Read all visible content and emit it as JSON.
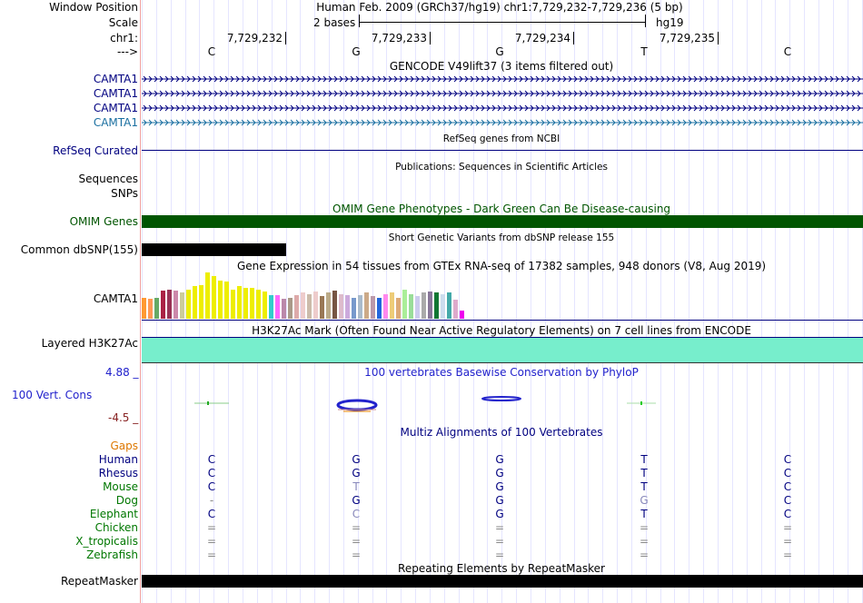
{
  "header": {
    "window_position_label": "Window Position",
    "window_position_value": "Human Feb. 2009 (GRCh37/hg19)   chr1:7,729,232-7,729,236 (5 bp)",
    "scale_label": "Scale",
    "scale_bases": "2 bases",
    "scale_db": "hg19",
    "chr_label": "chr1:",
    "arrow_label": "--->",
    "coords": [
      "7,729,232",
      "7,729,233",
      "7,729,234",
      "7,729,235"
    ],
    "bases": [
      "C",
      "G",
      "G",
      "T",
      "C"
    ]
  },
  "gencode": {
    "title": "GENCODE V49lift37 (3 items filtered out)",
    "items": [
      "CAMTA1",
      "CAMTA1",
      "CAMTA1",
      "CAMTA1"
    ]
  },
  "refseq": {
    "label": "RefSeq Curated",
    "title": "RefSeq genes from NCBI"
  },
  "publications": {
    "label1": "Sequences",
    "label2": "SNPs",
    "title": "Publications: Sequences in Scientific Articles"
  },
  "omim": {
    "label": "OMIM Genes",
    "title": "OMIM Gene Phenotypes - Dark Green Can Be Disease-causing"
  },
  "dbsnp": {
    "label": "Common dbSNP(155)",
    "title": "Short Genetic Variants from dbSNP release 155"
  },
  "gtex": {
    "label": "CAMTA1",
    "title": "Gene Expression in 54 tissues from GTEx RNA-seq of 17382 samples, 948 donors (V8, Aug 2019)",
    "bars": [
      {
        "h": 0.45,
        "c": "#ff9933"
      },
      {
        "h": 0.42,
        "c": "#ff9955"
      },
      {
        "h": 0.45,
        "c": "#66aa66"
      },
      {
        "h": 0.6,
        "c": "#aa2244"
      },
      {
        "h": 0.62,
        "c": "#993355"
      },
      {
        "h": 0.6,
        "c": "#cc88aa"
      },
      {
        "h": 0.55,
        "c": "#cccc99"
      },
      {
        "h": 0.62,
        "c": "#eeee00"
      },
      {
        "h": 0.7,
        "c": "#eeee00"
      },
      {
        "h": 0.72,
        "c": "#eeee00"
      },
      {
        "h": 0.98,
        "c": "#eeee00"
      },
      {
        "h": 0.9,
        "c": "#eeee00"
      },
      {
        "h": 0.8,
        "c": "#eeee00"
      },
      {
        "h": 0.78,
        "c": "#eeee00"
      },
      {
        "h": 0.62,
        "c": "#eeee00"
      },
      {
        "h": 0.7,
        "c": "#eeee00"
      },
      {
        "h": 0.66,
        "c": "#eeee00"
      },
      {
        "h": 0.66,
        "c": "#eeee00"
      },
      {
        "h": 0.62,
        "c": "#eeee00"
      },
      {
        "h": 0.58,
        "c": "#eeee00"
      },
      {
        "h": 0.5,
        "c": "#33cccc"
      },
      {
        "h": 0.5,
        "c": "#ff66ff"
      },
      {
        "h": 0.42,
        "c": "#bb88aa"
      },
      {
        "h": 0.45,
        "c": "#aa9988"
      },
      {
        "h": 0.5,
        "c": "#ddaaaa"
      },
      {
        "h": 0.55,
        "c": "#eecccc"
      },
      {
        "h": 0.52,
        "c": "#ccbbaa"
      },
      {
        "h": 0.58,
        "c": "#eecccc"
      },
      {
        "h": 0.48,
        "c": "#997755"
      },
      {
        "h": 0.55,
        "c": "#bbaa88"
      },
      {
        "h": 0.6,
        "c": "#775544"
      },
      {
        "h": 0.52,
        "c": "#ddbbcc"
      },
      {
        "h": 0.5,
        "c": "#ccaadd"
      },
      {
        "h": 0.45,
        "c": "#7799cc"
      },
      {
        "h": 0.5,
        "c": "#aabbcc"
      },
      {
        "h": 0.55,
        "c": "#ccaa88"
      },
      {
        "h": 0.48,
        "c": "#bb99aa"
      },
      {
        "h": 0.45,
        "c": "#2266dd"
      },
      {
        "h": 0.52,
        "c": "#ff88ee"
      },
      {
        "h": 0.55,
        "c": "#eecc77"
      },
      {
        "h": 0.45,
        "c": "#ddaa77"
      },
      {
        "h": 0.62,
        "c": "#aaee99"
      },
      {
        "h": 0.52,
        "c": "#99dd99"
      },
      {
        "h": 0.48,
        "c": "#ccccee"
      },
      {
        "h": 0.55,
        "c": "#aaaaaa"
      },
      {
        "h": 0.58,
        "c": "#887799"
      },
      {
        "h": 0.55,
        "c": "#117733"
      },
      {
        "h": 0.52,
        "c": "#ccddee"
      },
      {
        "h": 0.55,
        "c": "#44aaaa"
      },
      {
        "h": 0.4,
        "c": "#ddaacc"
      },
      {
        "h": 0.18,
        "c": "#ee00ee"
      }
    ]
  },
  "h3k27ac": {
    "label": "Layered H3K27Ac",
    "title": "H3K27Ac Mark (Often Found Near Active Regulatory Elements) on 7 cell lines from ENCODE"
  },
  "cons": {
    "label": "100 Vert. Cons",
    "max": "4.88 _",
    "min": "-4.5 _",
    "title": "100 vertebrates Basewise Conservation by PhyloP"
  },
  "multiz": {
    "title": "Multiz Alignments of 100 Vertebrates",
    "gaps_label": "Gaps",
    "species": [
      {
        "name": "Human",
        "bases": [
          "C",
          "G",
          "G",
          "T",
          "C"
        ]
      },
      {
        "name": "Rhesus",
        "bases": [
          "C",
          "G",
          "G",
          "T",
          "C"
        ]
      },
      {
        "name": "Mouse",
        "bases": [
          "C",
          "T",
          "G",
          "T",
          "C"
        ]
      },
      {
        "name": "Dog",
        "bases": [
          "-",
          "G",
          "G",
          "G",
          "C"
        ]
      },
      {
        "name": "Elephant",
        "bases": [
          "C",
          "C",
          "G",
          "T",
          "C"
        ]
      },
      {
        "name": "Chicken",
        "bases": [
          "=",
          "=",
          "=",
          "=",
          "="
        ]
      },
      {
        "name": "X_tropicalis",
        "bases": [
          "=",
          "=",
          "=",
          "=",
          "="
        ]
      },
      {
        "name": "Zebrafish",
        "bases": [
          "=",
          "=",
          "=",
          "=",
          "="
        ]
      }
    ]
  },
  "repeat": {
    "label": "RepeatMasker",
    "title": "Repeating Elements by RepeatMasker"
  },
  "colors": {
    "navy": "#000080",
    "gencode_last": "#1a6fa0",
    "omim": "#005500",
    "h3k27ac": "#77eecc",
    "cons_blue": "#2222cc",
    "cons_min": "#882222",
    "gaps": "#dd7700",
    "species_green": "#007700"
  }
}
